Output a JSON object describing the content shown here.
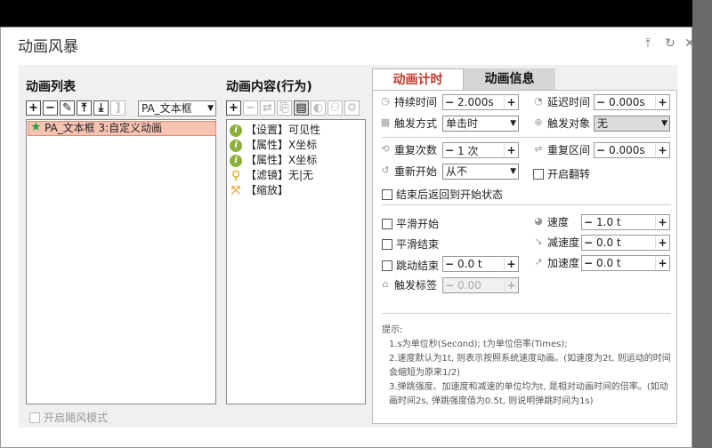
{
  "dialog": {
    "title": "动画风暴"
  },
  "anim_list": {
    "title": "动画列表",
    "dropdown": "PA_文本框",
    "items": [
      {
        "label": "PA_文本框 3:自定义动画"
      }
    ],
    "storm_mode": "开启飓风模式"
  },
  "behaviors": {
    "title": "动画内容(行为)",
    "items": [
      {
        "label": "【设置】可见性"
      },
      {
        "label": "【属性】X坐标"
      },
      {
        "label": "【属性】X坐标"
      },
      {
        "label": "【滤镜】无|无"
      },
      {
        "label": "【缩放】"
      }
    ]
  },
  "tabs": {
    "timing": "动画计时",
    "info": "动画信息"
  },
  "timing": {
    "duration_label": "持续时间",
    "duration": "2.000s",
    "delay_label": "延迟时间",
    "delay": "0.000s",
    "trigger_label": "触发方式",
    "trigger": "单击时",
    "target_label": "触发对象",
    "target": "无",
    "repeat_label": "重复次数",
    "repeat": "1 次",
    "interval_label": "重复区间",
    "interval": "0.000s",
    "restart_label": "重新开始",
    "restart": "从不",
    "flip_label": "开启翻转",
    "return_label": "结束后返回到开始状态",
    "smooth_start": "平滑开始",
    "smooth_end": "平滑结束",
    "bounce_label": "跳动结束",
    "bounce": "0.0 t",
    "trigger_tag_label": "触发标签",
    "trigger_tag": "0.00",
    "speed_label": "速度",
    "speed": "1.0 t",
    "decel_label": "减速度",
    "decel": "0.0 t",
    "accel_label": "加速度",
    "accel": "0.0 t",
    "tips_title": "提示:",
    "tip1": "1.s为单位秒(Second);  t为单位倍率(Times);",
    "tip2": "2.速度默认为1t, 则表示按照系统速度动画。(如速度为2t, 则运动的时间会缩短为原来1/2)",
    "tip3": "3.弹跳强度、加速度和减速的单位均为t, 是相对动画时间的倍率。(如动画时间2s, 弹跳强度值为0.5t, 则说明弹跳时间为1s)"
  }
}
